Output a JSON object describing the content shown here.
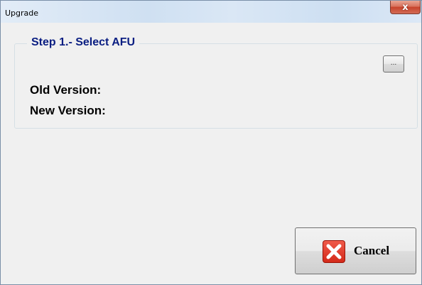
{
  "window": {
    "title": "Upgrade",
    "close_glyph": "x"
  },
  "group": {
    "title": "Step 1.- Select AFU",
    "browse_label": "...",
    "old_version_label": "Old Version:",
    "new_version_label": "New Version:"
  },
  "actions": {
    "cancel_label": "Cancel",
    "cancel_icon": "red-x-icon"
  },
  "colors": {
    "group_title": "#0a1e82",
    "cancel_icon": "#d42a1a",
    "close_button": "#c7432b"
  }
}
